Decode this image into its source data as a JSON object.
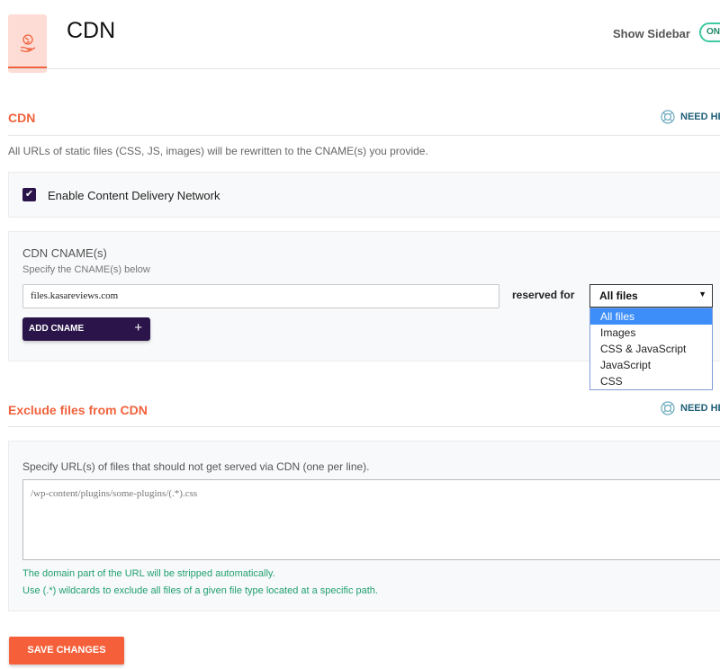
{
  "header": {
    "title": "CDN",
    "icon": "cdn-hand-globe-icon",
    "show_sidebar_label": "Show Sidebar",
    "toggle_label": "ON"
  },
  "cdn_section": {
    "heading": "CDN",
    "help_label": "NEED HELP?",
    "description": "All URLs of static files (CSS, JS, images) will be rewritten to the CNAME(s) you provide.",
    "enable_label": "Enable Content Delivery Network",
    "enable_checked": true
  },
  "cname": {
    "title": "CDN CNAME(s)",
    "subtitle": "Specify the CNAME(s) below",
    "value": "files.kasareviews.com",
    "reserved_label": "reserved for",
    "selected": "All files",
    "options": [
      "All files",
      "Images",
      "CSS & JavaScript",
      "JavaScript",
      "CSS"
    ],
    "add_label": "ADD CNAME",
    "add_icon": "+"
  },
  "exclude": {
    "heading": "Exclude files from CDN",
    "help_label": "NEED HELP?",
    "label": "Specify URL(s) of files that should not get served via CDN (one per line).",
    "value": "/wp-content/plugins/some-plugins/(.*).css",
    "notes": [
      "The domain part of the URL will be stripped automatically.",
      "Use (.*) wildcards to exclude all files of a given file type located at a specific path."
    ]
  },
  "save_label": "SAVE CHANGES",
  "colors": {
    "accent": "#f0623c",
    "primary": "#2a1449",
    "help": "#1f5f78",
    "note": "#21a070"
  }
}
